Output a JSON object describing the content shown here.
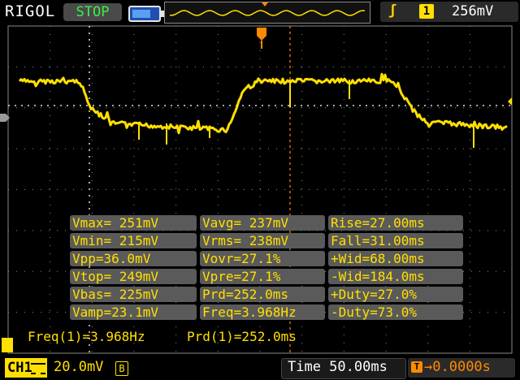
{
  "brand": "RIGOL",
  "run_state": "STOP",
  "trigger": {
    "edge_icon": "rising-edge",
    "source": "1",
    "level": "256mV"
  },
  "channel": {
    "label": "CH1",
    "scale": "20.0mV",
    "bw_limit": "B"
  },
  "timebase": "Time 50.00ms",
  "trigger_delay": "0.0000s",
  "trigger_marker_label": "T",
  "measurements": [
    [
      "Vmax= 251mV",
      "Vavg= 237mV",
      "Rise=27.00ms"
    ],
    [
      "Vmin= 215mV",
      "Vrms= 238mV",
      "Fall=31.00ms"
    ],
    [
      "Vpp=36.0mV",
      "Vovr=27.1%",
      "+Wid=68.00ms"
    ],
    [
      "Vtop= 249mV",
      "Vpre=27.1%",
      "-Wid=184.0ms"
    ],
    [
      "Vbas= 225mV",
      "Prd=252.0ms",
      "+Duty=27.0%"
    ],
    [
      "Vamp=23.1mV",
      "Freq=3.968Hz",
      "-Duty=73.0%"
    ]
  ],
  "freq_readout": "Freq(1)=3.968Hz",
  "prd_readout": "Prd(1)=252.0ms",
  "colors": {
    "trace": "#ffe000",
    "grid": "#8a8a8a",
    "trigger": "#ff8a00",
    "run": "#3cf04a",
    "panel": "#5a5a5a"
  }
}
